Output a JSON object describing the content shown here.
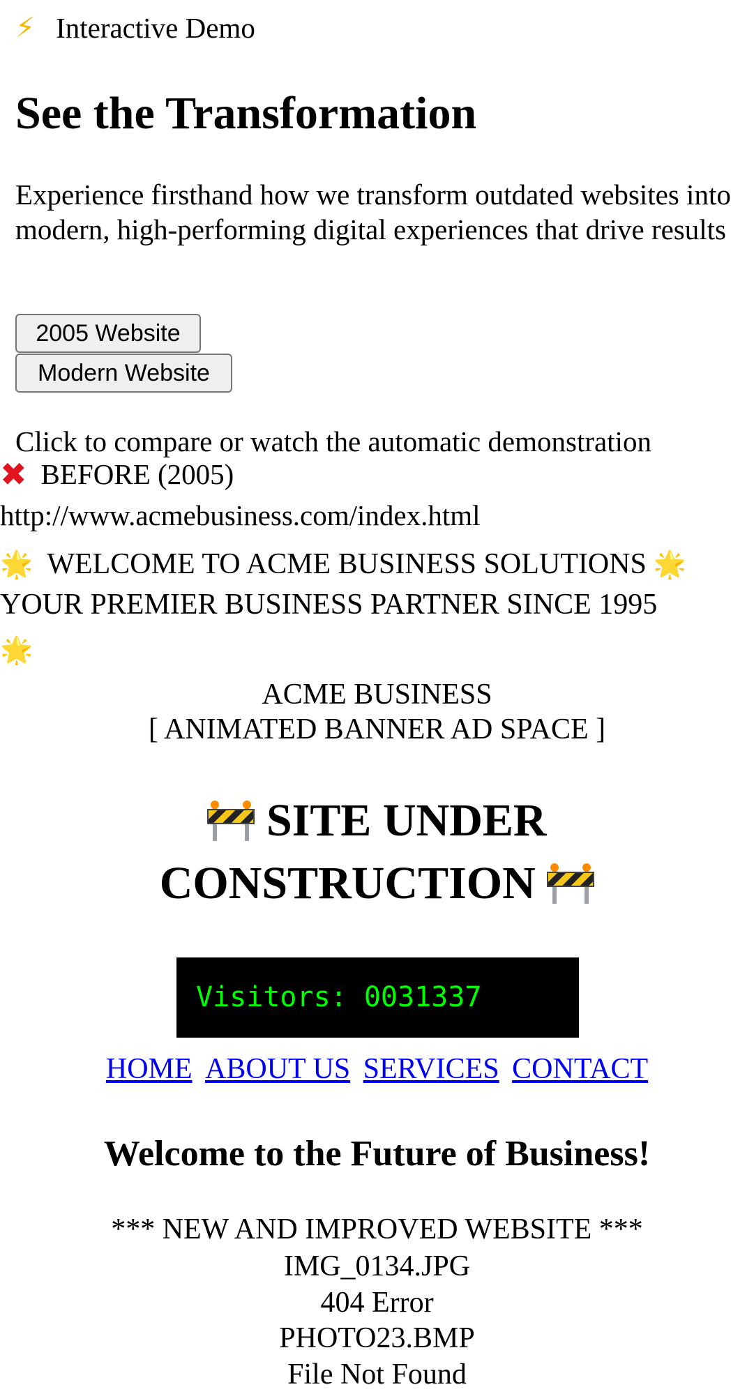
{
  "header": {
    "badge_icon": "lightning-icon",
    "badge_text": "Interactive Demo"
  },
  "hero": {
    "title": "See the Transformation",
    "subtitle": "Experience firsthand how we transform outdated websites into modern, high-performing digital experiences that drive results"
  },
  "toggle": {
    "old_label": "2005 Website",
    "modern_label": "Modern Website",
    "hint": "Click to compare or watch the automatic demonstration"
  },
  "before_panel": {
    "icon": "cross-mark-icon",
    "label": "BEFORE (2005)",
    "url": "http://www.acmebusiness.com/index.html",
    "welcome": "WELCOME TO ACME BUSINESS SOLUTIONS",
    "tagline": "YOUR PREMIER BUSINESS PARTNER SINCE 1995",
    "star_icon": "glowing-star-icon",
    "company_name": "ACME BUSINESS",
    "banner_ad": "[ ANIMATED BANNER AD SPACE ]",
    "construction_line1": "SITE UNDER",
    "construction_line2": "CONSTRUCTION",
    "construction_icon": "construction-barrier-icon",
    "visitor_counter": "Visitors: 0031337",
    "nav": {
      "home": "HOME",
      "about": "ABOUT US",
      "services": "SERVICES",
      "contact": "CONTACT"
    },
    "future_heading": "Welcome to the Future of Business!",
    "improved_text": "*** NEW AND IMPROVED WEBSITE ***",
    "broken_image_1": "IMG_0134.JPG",
    "error_text": "404 Error",
    "broken_image_2": "PHOTO23.BMP",
    "not_found_text": "File Not Found"
  },
  "colors": {
    "link": "#0000ee",
    "counter_bg": "#000000",
    "counter_text": "#00ff00",
    "cross": "#e0141e",
    "lightning": "#f2b705"
  }
}
